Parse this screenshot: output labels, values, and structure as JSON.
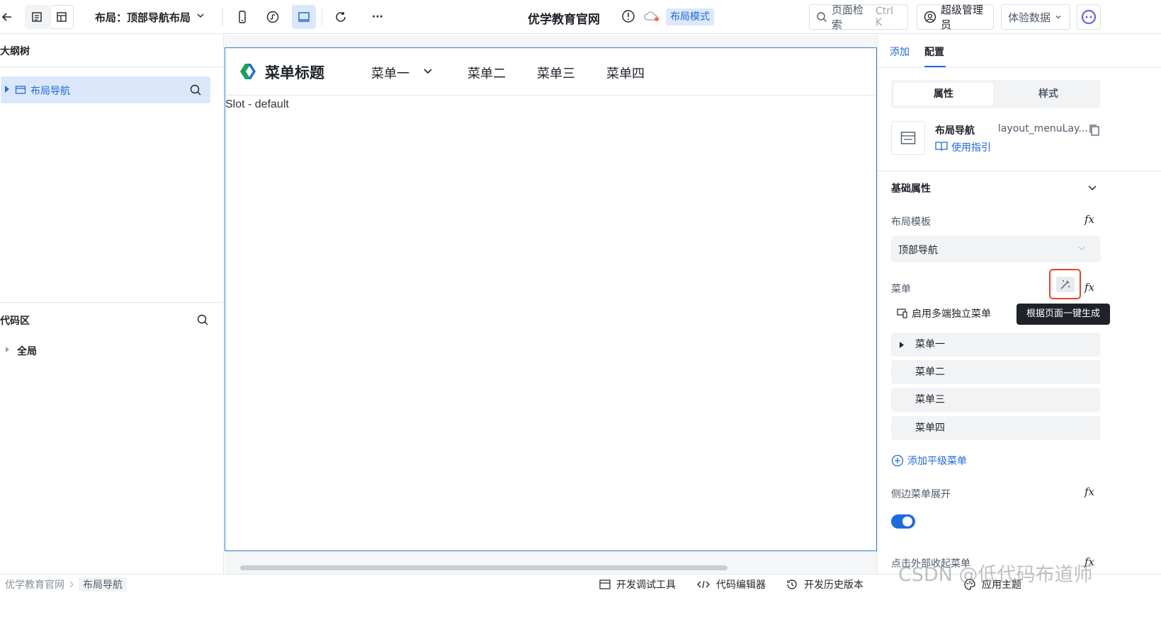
{
  "topbar": {
    "layout_title": "布局：顶部导航布局",
    "site_title": "优学教育官网",
    "layout_mode_badge": "布局模式",
    "search_label": "页面检索",
    "search_shortcut": "Ctrl K",
    "user_label": "超级管理员",
    "data_select_label": "体验数据",
    "more_label": "···"
  },
  "outline": {
    "title": "大纲树",
    "tree_item": "布局导航"
  },
  "code_area": {
    "title": "代码区",
    "tree_item": "全局"
  },
  "canvas": {
    "brand_title": "菜单标题",
    "menu_items": [
      "菜单一",
      "菜单二",
      "菜单三",
      "菜单四"
    ],
    "slot_text": "Slot - default"
  },
  "rightpanel": {
    "tabs": [
      "添加",
      "配置"
    ],
    "segments": [
      "属性",
      "样式"
    ],
    "component_name": "布局导航",
    "component_id": "layout_menuLay...",
    "guide_link": "使用指引",
    "section_title": "基础属性",
    "layout_template_label": "布局模板",
    "layout_template_value": "顶部导航",
    "menu_label": "菜单",
    "fx_label": "fx",
    "tooltip": "根据页面一键生成",
    "multi_menu_label": "启用多端独立菜单",
    "menu_rows": [
      "菜单一",
      "菜单二",
      "菜单三",
      "菜单四"
    ],
    "add_menu_label": "添加平级菜单",
    "side_expand_label": "侧边菜单展开",
    "collapse_outside_label": "点击外部收起菜单",
    "accent_color": "#1f6ae0"
  },
  "statusbar": {
    "breadcrumb": [
      "优学教育官网",
      "布局导航"
    ],
    "dev_tools": "开发调试工具",
    "code_editor": "代码编辑器",
    "history": "开发历史版本",
    "theme": "应用主题"
  },
  "watermark": "CSDN @低代码布道师"
}
